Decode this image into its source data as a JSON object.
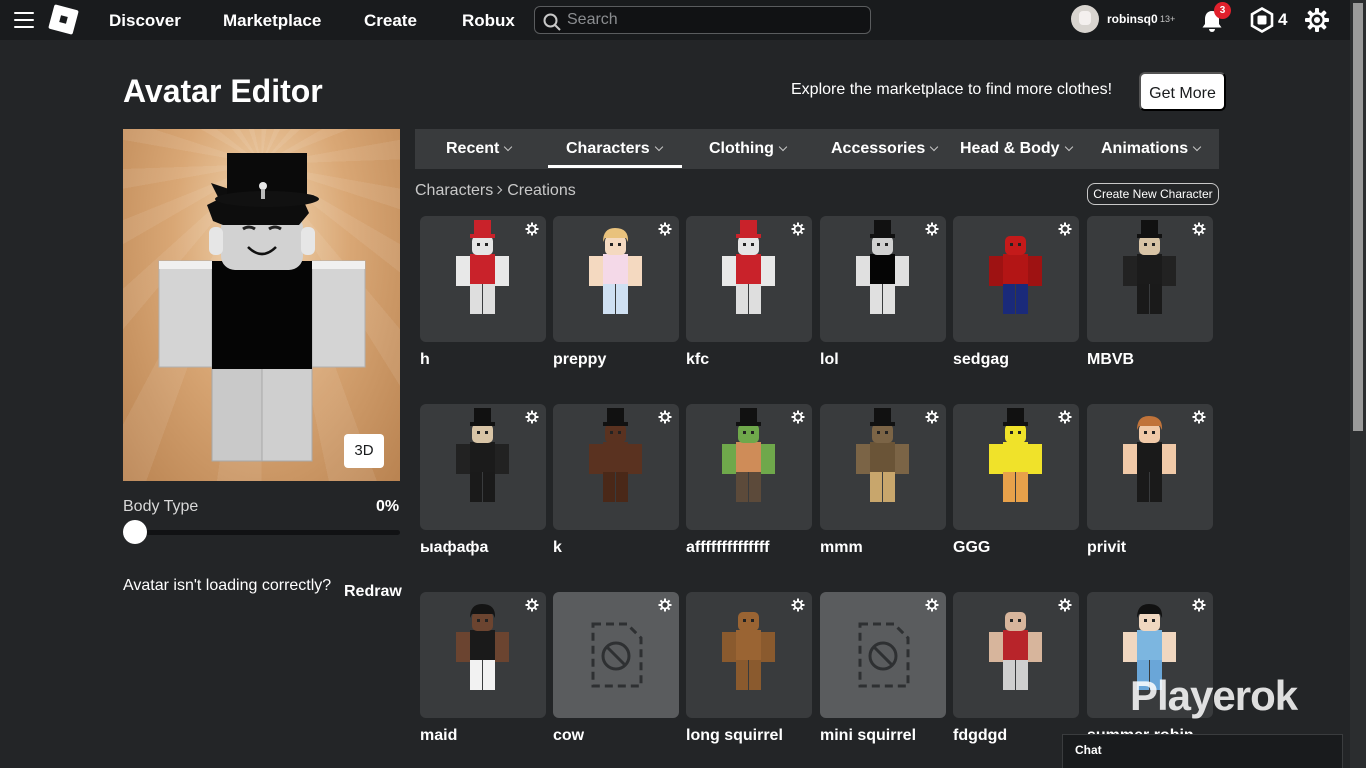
{
  "nav": {
    "links": [
      "Discover",
      "Marketplace",
      "Create",
      "Robux"
    ],
    "search_placeholder": "Search",
    "username": "robinsq0",
    "age_badge": "13+",
    "notifications": "3",
    "robux": "4"
  },
  "header": {
    "title": "Avatar Editor",
    "explore_text": "Explore the marketplace to find more clothes!",
    "get_more": "Get More"
  },
  "preview": {
    "btn_3d": "3D",
    "body_type_label": "Body Type",
    "body_type_value": "0%",
    "body_type_fraction": 0,
    "redraw_prompt": "Avatar isn't loading correctly?",
    "redraw_button": "Redraw"
  },
  "tabs": [
    {
      "label": "Recent"
    },
    {
      "label": "Characters"
    },
    {
      "label": "Clothing"
    },
    {
      "label": "Accessories"
    },
    {
      "label": "Head & Body"
    },
    {
      "label": "Animations"
    }
  ],
  "breadcrumb": {
    "root": "Characters",
    "current": "Creations"
  },
  "create_new": "Create New Character",
  "characters": [
    {
      "name": "h",
      "look": "kfc"
    },
    {
      "name": "preppy",
      "look": "blonde"
    },
    {
      "name": "kfc",
      "look": "kfc"
    },
    {
      "name": "lol",
      "look": "tophat-black"
    },
    {
      "name": "sedgag",
      "look": "spider"
    },
    {
      "name": "MBVB",
      "look": "suit"
    },
    {
      "name": "ыафафа",
      "look": "suit"
    },
    {
      "name": "k",
      "look": "choco"
    },
    {
      "name": "affffffffffffff",
      "look": "blocky-green"
    },
    {
      "name": "mmm",
      "look": "blocky-brown"
    },
    {
      "name": "GGG",
      "look": "sponge"
    },
    {
      "name": "privit",
      "look": "ginger"
    },
    {
      "name": "maid",
      "look": "maid"
    },
    {
      "name": "cow",
      "look": "broken"
    },
    {
      "name": "long squirrel",
      "look": "squirrel"
    },
    {
      "name": "mini squirrel",
      "look": "broken"
    },
    {
      "name": "fdgdgd",
      "look": "bald"
    },
    {
      "name": "summer robin",
      "look": "blue"
    }
  ],
  "watermark": "Playerok",
  "chat_label": "Chat"
}
